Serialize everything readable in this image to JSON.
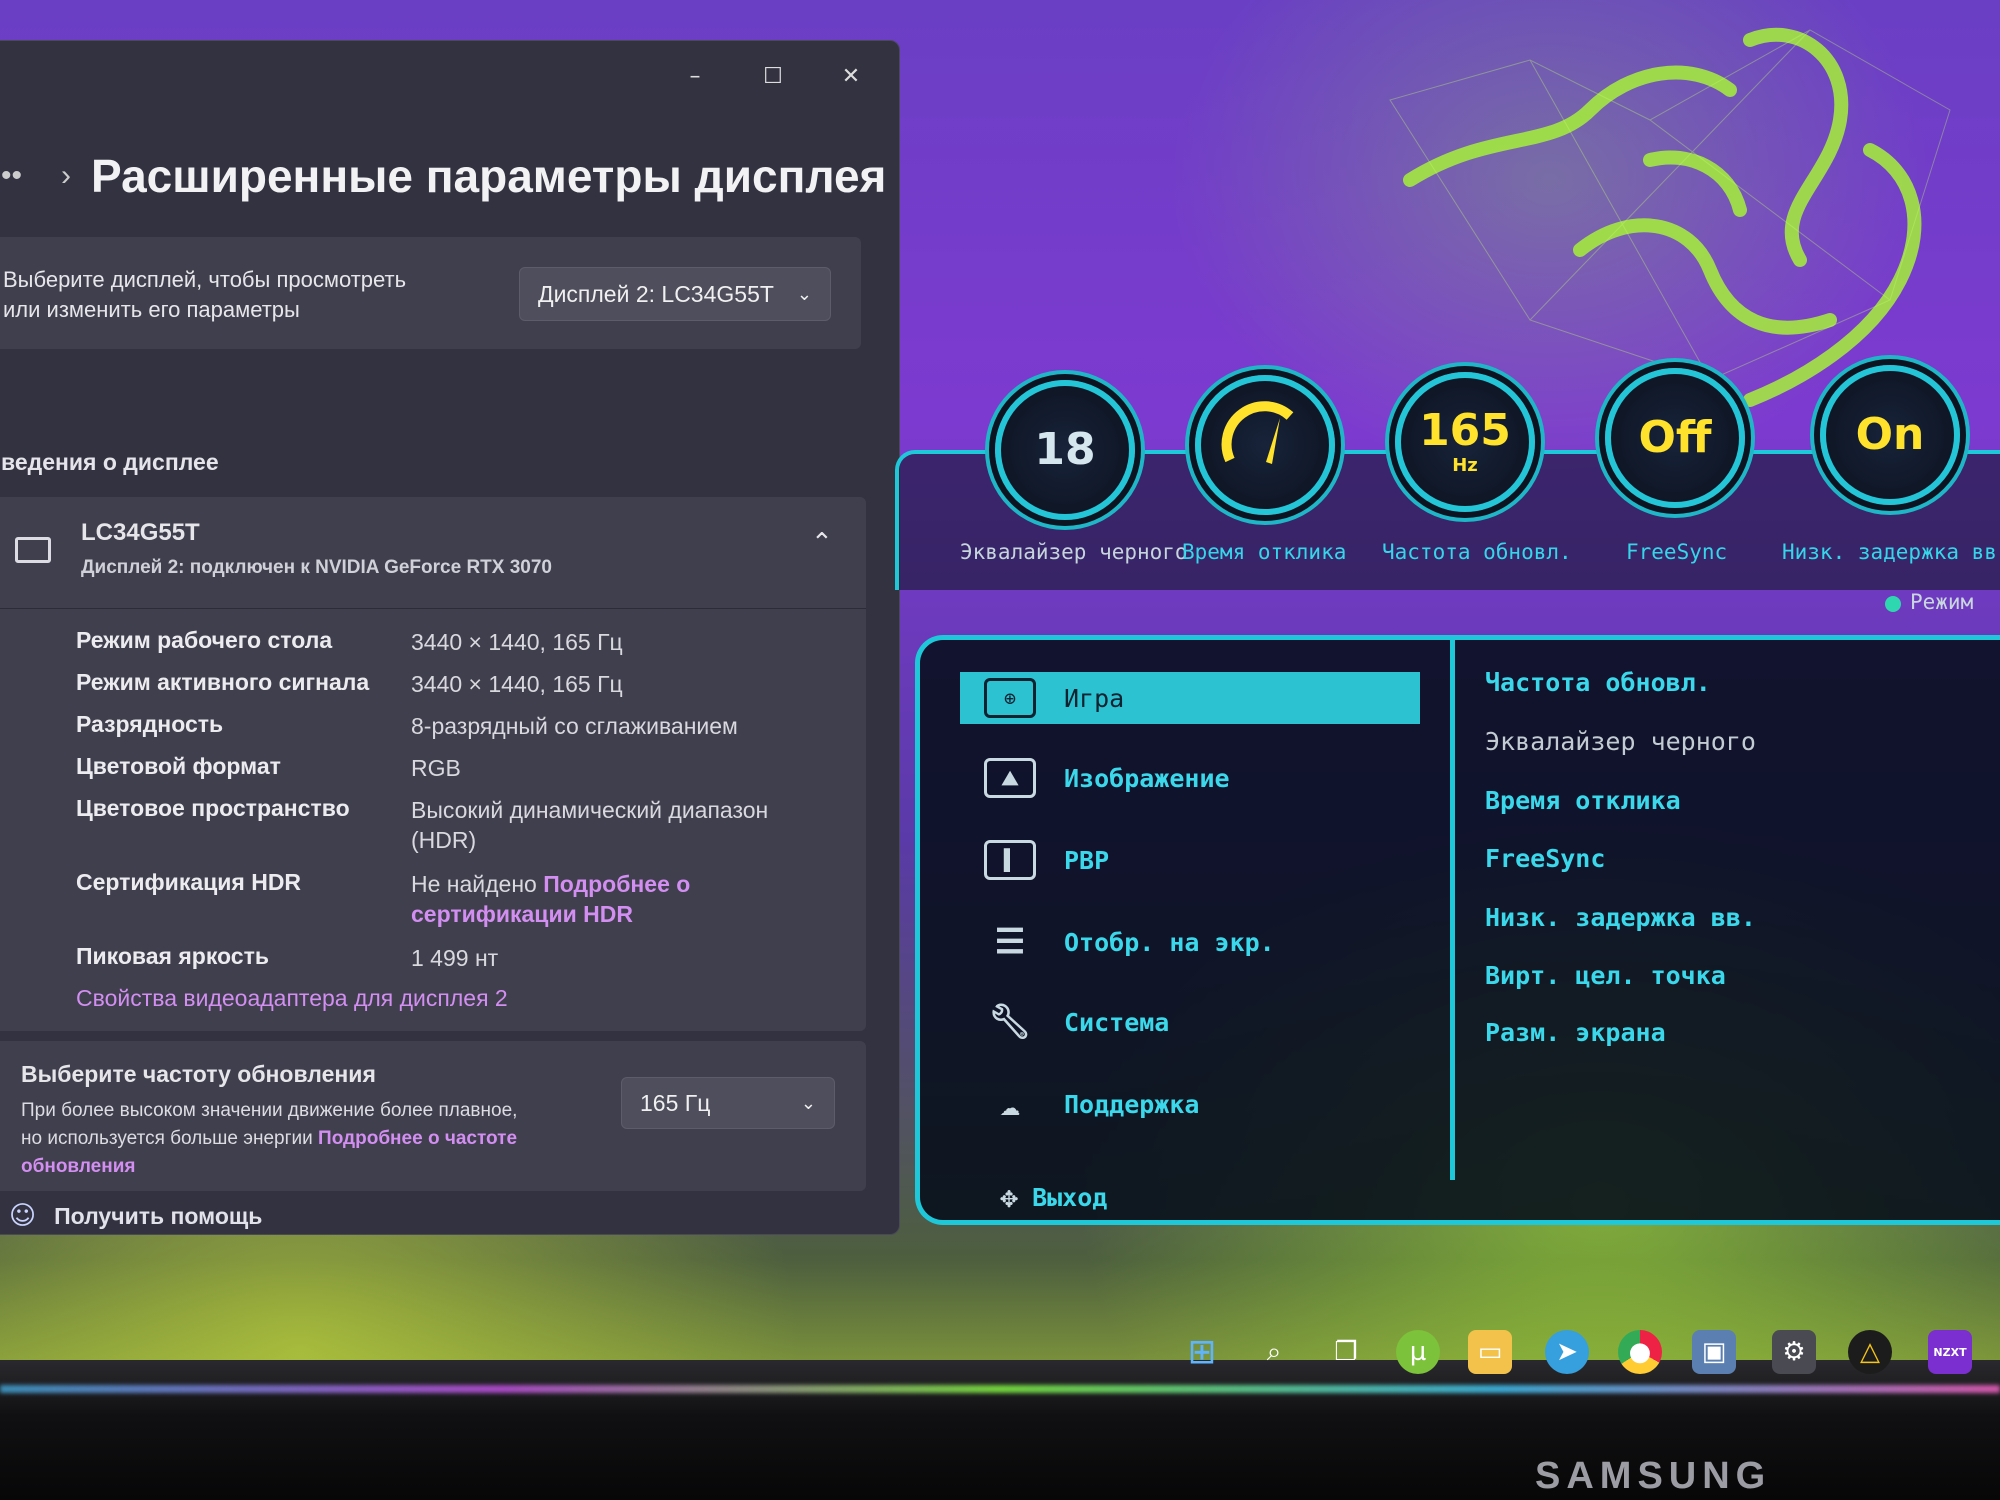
{
  "window": {
    "minimize_glyph": "–",
    "maximize_glyph": "☐",
    "close_glyph": "✕",
    "breadcrumb_dots": "••",
    "breadcrumb_chevron": "›",
    "title": "Расширенные параметры дисплея"
  },
  "display_select": {
    "prompt_line1": "Выберите дисплей, чтобы просмотреть",
    "prompt_line2": "или изменить его параметры",
    "selected": "Дисплей 2: LC34G55T"
  },
  "display_info": {
    "section_label": "ведения о дисплее",
    "monitor_name": "LC34G55T",
    "monitor_subtitle": "Дисплей 2: подключен к NVIDIA GeForce RTX 3070",
    "rows": [
      {
        "key": "Режим рабочего стола",
        "value": "3440 × 1440, 165 Гц"
      },
      {
        "key": "Режим активного сигнала",
        "value": "3440 × 1440, 165 Гц"
      },
      {
        "key": "Разрядность",
        "value": "8-разрядный со сглаживанием"
      },
      {
        "key": "Цветовой формат",
        "value": "RGB"
      },
      {
        "key": "Цветовое пространство",
        "value": "Высокий динамический диапазон (HDR)"
      },
      {
        "key": "Сертификация HDR",
        "value": "Не найдено",
        "link": "Подробнее о сертификации HDR"
      },
      {
        "key": "Пиковая яркость",
        "value": "1 499 нт"
      }
    ],
    "adapter_link": "Свойства видеоадаптера для дисплея 2"
  },
  "refresh": {
    "title": "Выберите частоту обновления",
    "desc_line1": "При более высоком значении движение более плавное,",
    "desc_line2": "но используется больше энергии",
    "link_part1": "Подробнее о частоте",
    "link_part2": "обновления",
    "selected": "165 Гц"
  },
  "help": {
    "label": "Получить помощь"
  },
  "osd": {
    "gauges": [
      {
        "value": "18",
        "unit": "",
        "label": "Эквалайзер черного"
      },
      {
        "value": "",
        "unit": "",
        "label": "Время отклика"
      },
      {
        "value": "165",
        "unit": "Hz",
        "label": "Частота обновл."
      },
      {
        "value": "Off",
        "unit": "",
        "label": "FreeSync"
      },
      {
        "value": "On",
        "unit": "",
        "label": "Низк. задержка вв"
      }
    ],
    "mode_label": "Режим",
    "menu": [
      {
        "label": "Игра",
        "icon": "gamepad-icon"
      },
      {
        "label": "Изображение",
        "icon": "image-icon"
      },
      {
        "label": "PBP",
        "icon": "pbp-icon"
      },
      {
        "label": "Отобр. на экр.",
        "icon": "sliders-icon"
      },
      {
        "label": "Система",
        "icon": "wrench-icon"
      },
      {
        "label": "Поддержка",
        "icon": "help-cloud-icon"
      }
    ],
    "submenu": [
      "Частота обновл.",
      "Эквалайзер черного",
      "Время отклика",
      "FreeSync",
      "Низк. задержка вв.",
      "Вирт. цел. точка",
      "Разм. экрана"
    ],
    "exit_label": "Выход"
  },
  "taskbar": {
    "nzxt_label": "NZXT"
  },
  "monitor_brand": "SAMSUNG",
  "colors": {
    "osd_accent": "#1fc8d8",
    "osd_highlight": "#2cc2d2",
    "gauge_yellow": "#ffe22c",
    "link": "#d28ef0",
    "window_bg": "#333240"
  }
}
